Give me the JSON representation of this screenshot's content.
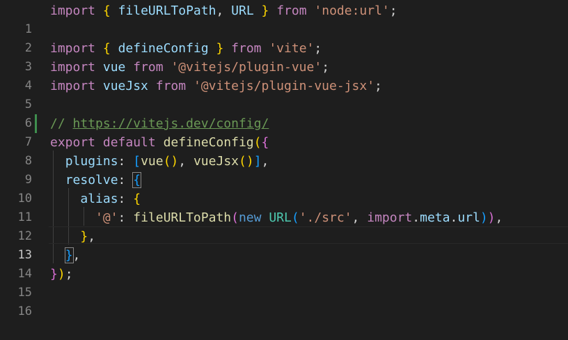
{
  "editor": {
    "language": "javascript",
    "active_line": 13,
    "lines": [
      {
        "n": "1"
      },
      {
        "n": "2"
      },
      {
        "n": "3"
      },
      {
        "n": "4"
      },
      {
        "n": "5"
      },
      {
        "n": "6"
      },
      {
        "n": "7"
      },
      {
        "n": "8"
      },
      {
        "n": "9"
      },
      {
        "n": "10"
      },
      {
        "n": "11"
      },
      {
        "n": "12"
      },
      {
        "n": "13"
      },
      {
        "n": "14"
      },
      {
        "n": "15"
      },
      {
        "n": "16"
      }
    ],
    "tokens": {
      "import": "import",
      "from": "from",
      "export": "export",
      "default": "default",
      "new": "new",
      "fileURLToPath": "fileURLToPath",
      "URL": "URL",
      "node_url": "'node:url'",
      "defineConfig": "defineConfig",
      "vite": "'vite'",
      "vue": "vue",
      "plugin_vue": "'@vitejs/plugin-vue'",
      "vueJsx": "vueJsx",
      "plugin_vue_jsx": "'@vitejs/plugin-vue-jsx'",
      "comment_prefix": "// ",
      "comment_url": "https://vitejs.dev/config/",
      "plugins": "plugins",
      "resolve": "resolve",
      "alias": "alias",
      "at_key": "'@'",
      "src": "'./src'",
      "meta": "meta",
      "url": "url"
    }
  },
  "colors": {
    "background": "#1e1e1e",
    "keyword_control": "#c586c0",
    "keyword": "#569cd6",
    "function": "#dcdcaa",
    "variable": "#9cdcfe",
    "class": "#4ec9b0",
    "string": "#ce9178",
    "comment": "#6a9955",
    "bracket_level1": "#ffd700",
    "bracket_level2": "#da70d6",
    "bracket_level3": "#179fff",
    "modified_marker": "#3f8f4f"
  }
}
